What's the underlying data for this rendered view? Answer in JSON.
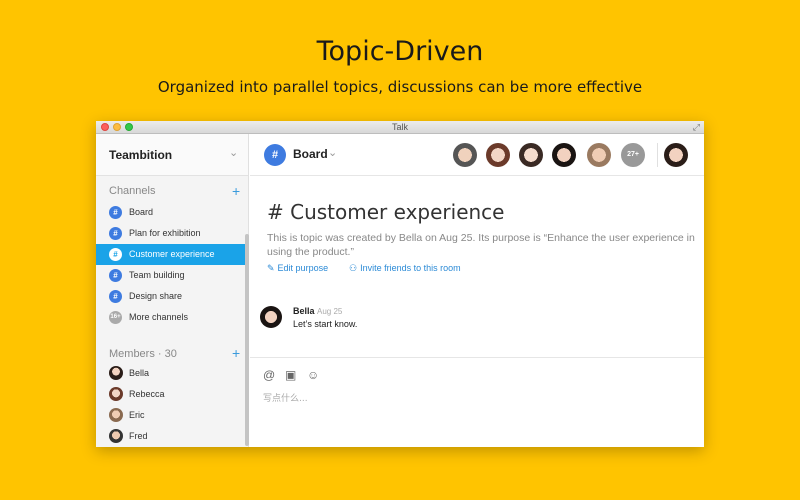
{
  "hero": {
    "title": "Topic-Driven",
    "subtitle": "Organized into parallel topics, discussions can be more effective"
  },
  "window": {
    "title": "Talk"
  },
  "sidebar": {
    "org_name": "Teambition",
    "channels_label": "Channels",
    "channels": [
      {
        "label": "Board",
        "badge": "#",
        "active": false
      },
      {
        "label": "Plan for exhibition",
        "badge": "#",
        "active": false
      },
      {
        "label": "Customer experience",
        "badge": "#",
        "active": true
      },
      {
        "label": "Team building",
        "badge": "#",
        "active": false
      },
      {
        "label": "Design share",
        "badge": "#",
        "active": false
      },
      {
        "label": "More channels",
        "badge": "16+",
        "active": false
      }
    ],
    "members_label": "Members · 30",
    "members": [
      {
        "name": "Bella"
      },
      {
        "name": "Rebecca"
      },
      {
        "name": "Eric"
      },
      {
        "name": "Fred"
      }
    ]
  },
  "header": {
    "room_badge": "#",
    "room_name": "Board",
    "member_overflow": "27+"
  },
  "topic": {
    "title": "# Customer experience",
    "description": "This is topic was created by Bella on Aug 25. Its purpose is “Enhance the user experience in using the product.”",
    "edit_purpose": "Edit purpose",
    "invite": "Invite friends to this room"
  },
  "message": {
    "author": "Bella",
    "time": "Aug 25",
    "text": "Let’s start know."
  },
  "composer": {
    "placeholder": "写点什么..."
  },
  "colors": {
    "background": "#FFC400",
    "accent": "#1AA3E8",
    "channel_badge": "#3E7BE0"
  }
}
